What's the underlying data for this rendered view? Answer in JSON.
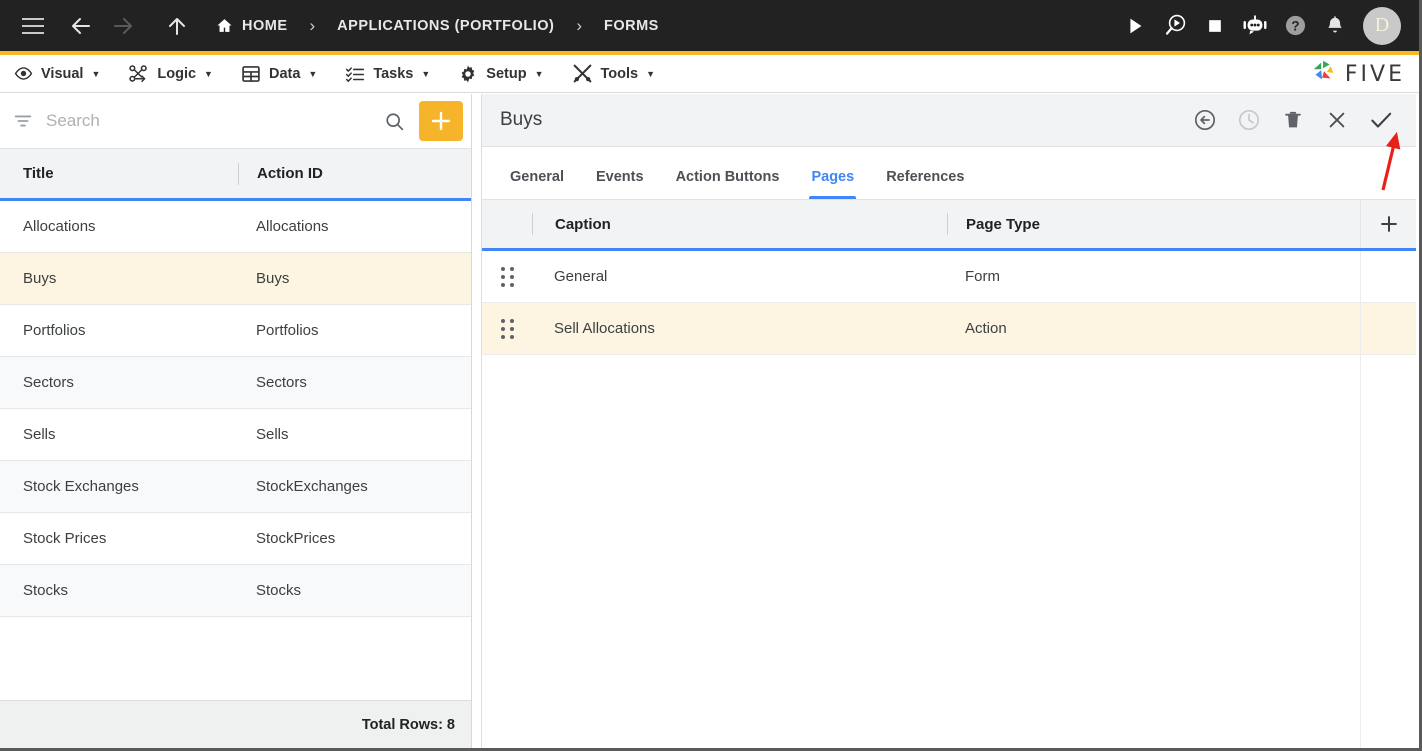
{
  "topbar": {
    "menu_icon": "hamburger-icon",
    "back_label": "Back",
    "forward_label": "Forward",
    "up_label": "Up",
    "breadcrumbs": [
      {
        "label": "HOME",
        "icon": "home-icon"
      },
      {
        "label": "APPLICATIONS (PORTFOLIO)",
        "icon": ""
      },
      {
        "label": "FORMS",
        "icon": ""
      }
    ],
    "separator": "›",
    "actions": [
      {
        "name": "run-icon",
        "label": "Run"
      },
      {
        "name": "debug-icon",
        "label": "Debug"
      },
      {
        "name": "stop-icon",
        "label": "Stop"
      },
      {
        "name": "chatbot-icon",
        "label": "Assistant"
      },
      {
        "name": "help-icon",
        "label": "Help"
      },
      {
        "name": "notifications-bell-icon",
        "label": "Notifications"
      }
    ],
    "avatar_initial": "D"
  },
  "menubar": {
    "items": [
      {
        "label": "Visual",
        "icon": "eye-icon",
        "caret": "▼"
      },
      {
        "label": "Logic",
        "icon": "logic-nodes-icon",
        "caret": "▼"
      },
      {
        "label": "Data",
        "icon": "grid-table-icon",
        "caret": "▼"
      },
      {
        "label": "Tasks",
        "icon": "checklist-icon",
        "caret": "▼"
      },
      {
        "label": "Setup",
        "icon": "gear-icon",
        "caret": "▼"
      },
      {
        "label": "Tools",
        "icon": "tools-icon",
        "caret": "▼"
      }
    ],
    "brand": "FIVE"
  },
  "left_panel": {
    "search": {
      "placeholder": "Search",
      "value": "",
      "filter_icon": "filter-icon",
      "search_icon": "search-icon"
    },
    "add_button_label": "+",
    "columns": [
      "Title",
      "Action ID"
    ],
    "rows": [
      {
        "title": "Allocations",
        "action_id": "Allocations",
        "selected": false
      },
      {
        "title": "Buys",
        "action_id": "Buys",
        "selected": true
      },
      {
        "title": "Portfolios",
        "action_id": "Portfolios",
        "selected": false
      },
      {
        "title": "Sectors",
        "action_id": "Sectors",
        "selected": false
      },
      {
        "title": "Sells",
        "action_id": "Sells",
        "selected": false
      },
      {
        "title": "Stock Exchanges",
        "action_id": "StockExchanges",
        "selected": false
      },
      {
        "title": "Stock Prices",
        "action_id": "StockPrices",
        "selected": false
      },
      {
        "title": "Stocks",
        "action_id": "Stocks",
        "selected": false
      }
    ],
    "footer": "Total Rows: 8"
  },
  "right_panel": {
    "title": "Buys",
    "toolbar": [
      {
        "name": "revert-icon",
        "label": "Revert",
        "disabled": false
      },
      {
        "name": "history-clock-icon",
        "label": "History",
        "disabled": true
      },
      {
        "name": "delete-trash-icon",
        "label": "Delete",
        "disabled": false
      },
      {
        "name": "close-x-icon",
        "label": "Cancel",
        "disabled": false
      },
      {
        "name": "save-check-icon",
        "label": "Save",
        "disabled": false
      }
    ],
    "tabs": [
      {
        "label": "General",
        "active": false
      },
      {
        "label": "Events",
        "active": false
      },
      {
        "label": "Action Buttons",
        "active": false
      },
      {
        "label": "Pages",
        "active": true
      },
      {
        "label": "References",
        "active": false
      }
    ],
    "pages_table": {
      "columns": [
        "Caption",
        "Page Type"
      ],
      "add_button_label": "+",
      "rows": [
        {
          "caption": "General",
          "page_type": "Form",
          "selected": false,
          "handle": "drag-handle-icon"
        },
        {
          "caption": "Sell Allocations",
          "page_type": "Action",
          "selected": true,
          "handle": "drag-handle-icon"
        }
      ]
    }
  },
  "annotation": {
    "name": "red-arrow-pointing-to-save",
    "color": "#e8201a"
  },
  "colors": {
    "topbar_bg": "#222222",
    "accent_yellow": "#f7b924",
    "add_button": "#f6b42b",
    "table_header_bg": "#f1f3f4",
    "active_blue": "#4285f4",
    "selected_row": "#fdf5e2"
  }
}
